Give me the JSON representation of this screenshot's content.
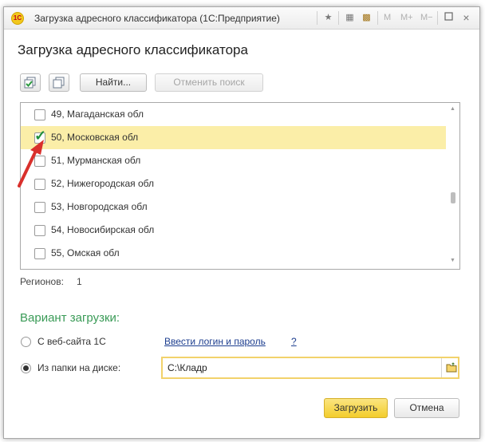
{
  "window": {
    "title": "Загрузка адресного классификатора  (1С:Предприятие)",
    "memory": {
      "m": "M",
      "m_plus": "M+",
      "m_minus": "M−"
    }
  },
  "heading": "Загрузка адресного классификатора",
  "toolbar": {
    "find_label": "Найти...",
    "cancel_search_label": "Отменить поиск"
  },
  "regions_list": [
    {
      "label": "49, Магаданская обл",
      "checked": false,
      "selected": false
    },
    {
      "label": "50, Московская обл",
      "checked": true,
      "selected": true
    },
    {
      "label": "51, Мурманская обл",
      "checked": false,
      "selected": false
    },
    {
      "label": "52, Нижегородская обл",
      "checked": false,
      "selected": false
    },
    {
      "label": "53, Новгородская обл",
      "checked": false,
      "selected": false
    },
    {
      "label": "54, Новосибирская обл",
      "checked": false,
      "selected": false
    },
    {
      "label": "55, Омская обл",
      "checked": false,
      "selected": false
    }
  ],
  "regions_count": {
    "label": "Регионов:",
    "value": "1"
  },
  "load_variant": {
    "label": "Вариант загрузки:",
    "options": [
      {
        "label": "С веб-сайта 1С",
        "selected": false
      },
      {
        "label": "Из папки на диске:",
        "selected": true
      }
    ],
    "login_link": "Ввести логин и пароль",
    "help_link": "?",
    "folder_path": "C:\\Кладр"
  },
  "buttons": {
    "load": "Загрузить",
    "cancel": "Отмена"
  },
  "colors": {
    "accent_green": "#3a9b57",
    "selected_row": "#fbeea8",
    "primary_button": "#f3cd2c",
    "arrow": "#d9302c"
  }
}
